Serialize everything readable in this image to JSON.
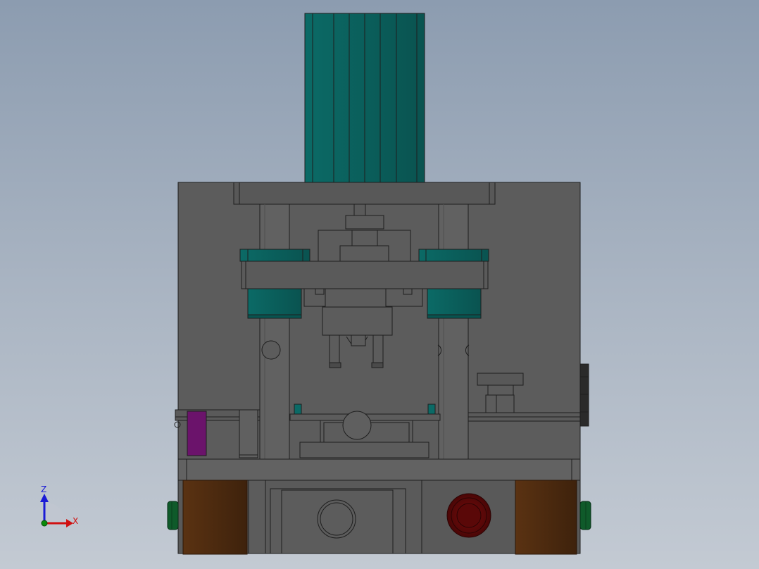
{
  "viewport": {
    "triad": {
      "z_label": "Z",
      "x_label": "X",
      "colors": {
        "z": "#1a1ad6",
        "x": "#d01010",
        "origin": "#0a8a0a"
      }
    }
  },
  "colors": {
    "body": "#5c5c5c",
    "body_dark": "#4c4c4c",
    "edge": "#202020",
    "teal": "#0a5f5c",
    "teal_light": "#107a74",
    "brown": "#4a2810",
    "purple": "#6b136b",
    "red": "#6a0a0a",
    "green": "#0f5a2a"
  }
}
